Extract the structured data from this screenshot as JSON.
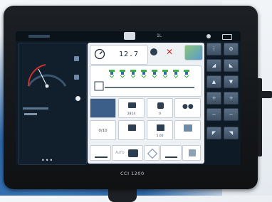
{
  "device": {
    "brand_label": "CCI 1200"
  },
  "topbar": {
    "right_label": "1L"
  },
  "main": {
    "speed_value": "12.7",
    "grid_labels": [
      "0/10",
      "2814",
      "0",
      "5.00"
    ],
    "bottom_label": "AUTO"
  },
  "colors": {
    "screen_bg": "#0e1a26",
    "main_bg": "#eef1f4",
    "nozzle_green": "#3fae49",
    "nozzle_blue": "#2f6ab3",
    "button": "#4d6278",
    "accent_red": "#c8312c"
  },
  "icons": {
    "speedometer": "speedometer-icon",
    "nozzle": "spray-nozzle-icon",
    "home": "home-icon",
    "wrench": "wrench-icon",
    "arrow_down": "arrow-down-icon",
    "arrow_up": "arrow-up-icon",
    "plus": "plus-icon",
    "minus": "minus-icon"
  }
}
